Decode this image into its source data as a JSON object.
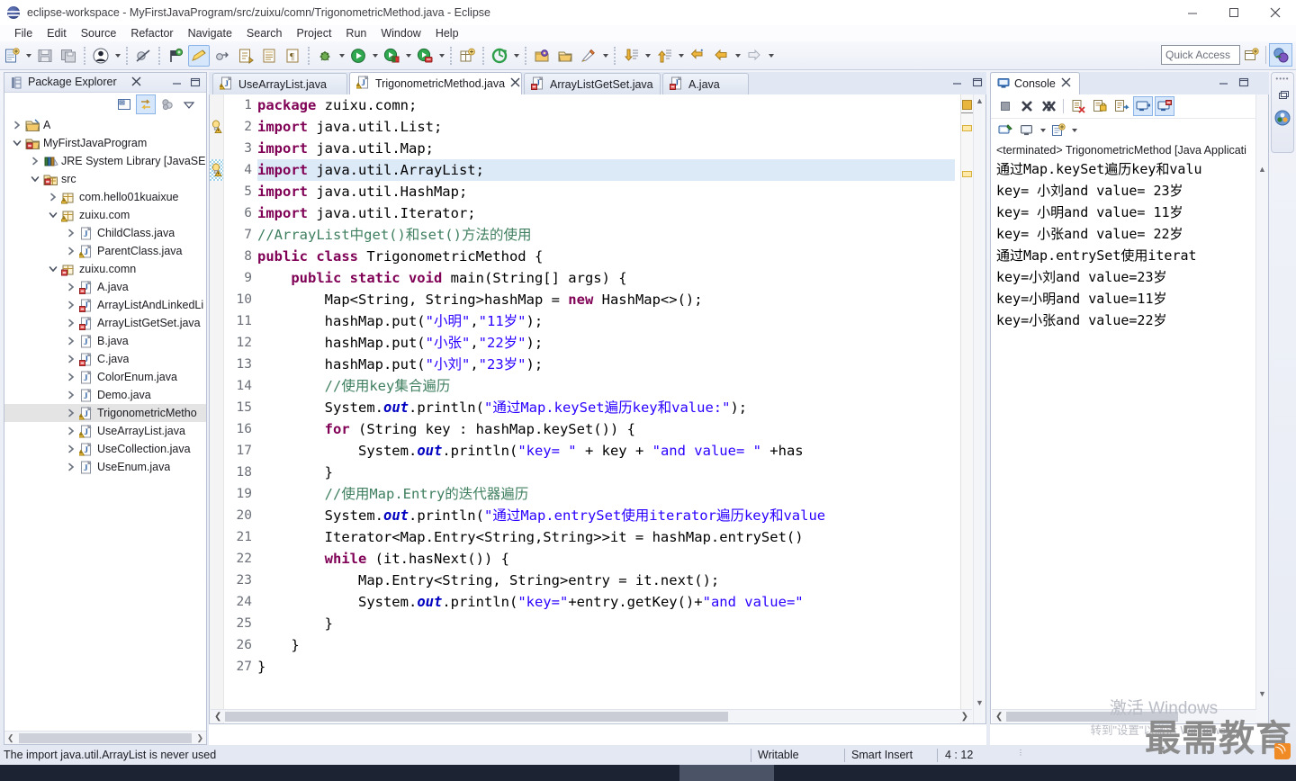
{
  "window": {
    "title": "eclipse-workspace - MyFirstJavaProgram/src/zuixu/comn/TrigonometricMethod.java - Eclipse",
    "app_icon": "eclipse-globe-icon",
    "minimize": "minimize-button",
    "maximize": "maximize-button",
    "close": "close-button"
  },
  "menu": {
    "items": [
      {
        "label": "File"
      },
      {
        "label": "Edit"
      },
      {
        "label": "Source"
      },
      {
        "label": "Refactor"
      },
      {
        "label": "Navigate"
      },
      {
        "label": "Search"
      },
      {
        "label": "Project"
      },
      {
        "label": "Run"
      },
      {
        "label": "Window"
      },
      {
        "label": "Help"
      }
    ]
  },
  "toolbar": {
    "buttons": [
      {
        "name": "new-wizard-icon",
        "kind": "new"
      },
      {
        "name": "new-dropdown-arrow",
        "kind": "arrow"
      },
      {
        "name": "save-icon",
        "kind": "save"
      },
      {
        "name": "save-all-icon",
        "kind": "saveall"
      },
      {
        "name": "sep1",
        "kind": "sep"
      },
      {
        "name": "person-icon",
        "kind": "person"
      },
      {
        "name": "person-dropdown-arrow",
        "kind": "arrow"
      },
      {
        "name": "sep2",
        "kind": "sep"
      },
      {
        "name": "skip-breakpoints-icon",
        "kind": "skip"
      },
      {
        "name": "sep3",
        "kind": "sep"
      },
      {
        "name": "toggle-breakpoint-icon",
        "kind": "flag"
      },
      {
        "name": "edit-pencil-icon",
        "kind": "pencil",
        "selected": true
      },
      {
        "name": "external-tools-icon",
        "kind": "ext"
      },
      {
        "name": "new-java-class-icon",
        "kind": "javaclass"
      },
      {
        "name": "new-java-interface-icon",
        "kind": "javaiface"
      },
      {
        "name": "paragraph-icon",
        "kind": "para"
      },
      {
        "name": "sep4",
        "kind": "sep"
      },
      {
        "name": "debug-bug-icon",
        "kind": "bug"
      },
      {
        "name": "debug-dropdown-arrow",
        "kind": "arrow"
      },
      {
        "name": "run-icon",
        "kind": "run"
      },
      {
        "name": "run-dropdown-arrow",
        "kind": "arrow"
      },
      {
        "name": "coverage-icon",
        "kind": "cov"
      },
      {
        "name": "coverage-dropdown-arrow",
        "kind": "arrow"
      },
      {
        "name": "run-last-icon",
        "kind": "runlast"
      },
      {
        "name": "run-last-dropdown-arrow",
        "kind": "arrow"
      },
      {
        "name": "sep5",
        "kind": "sep"
      },
      {
        "name": "new-package-icon",
        "kind": "newpkg"
      },
      {
        "name": "sep6",
        "kind": "sep"
      },
      {
        "name": "refresh-icon",
        "kind": "refresh"
      },
      {
        "name": "refresh-dropdown-arrow",
        "kind": "arrow"
      },
      {
        "name": "sep7",
        "kind": "sep"
      },
      {
        "name": "open-type-icon",
        "kind": "opentype"
      },
      {
        "name": "open-folder-icon",
        "kind": "openfolder"
      },
      {
        "name": "marker-pen-icon",
        "kind": "marker"
      },
      {
        "name": "marker-dropdown-arrow",
        "kind": "arrow"
      },
      {
        "name": "sep8",
        "kind": "sep"
      },
      {
        "name": "next-annotation-icon",
        "kind": "downarrow"
      },
      {
        "name": "next-annotation-dropdown-arrow",
        "kind": "arrow"
      },
      {
        "name": "previous-annotation-icon",
        "kind": "uparrow"
      },
      {
        "name": "previous-annotation-dropdown-arrow",
        "kind": "arrow"
      },
      {
        "name": "last-edit-location-icon",
        "kind": "lastedit"
      },
      {
        "name": "back-icon",
        "kind": "back"
      },
      {
        "name": "back-dropdown-arrow",
        "kind": "arrow"
      },
      {
        "name": "forward-icon",
        "kind": "forward"
      },
      {
        "name": "forward-dropdown-arrow",
        "kind": "arrow"
      }
    ],
    "quick_access_placeholder": "Quick Access",
    "perspective_new_icon": "open-perspective-icon",
    "perspective_java_icon": "java-perspective-icon"
  },
  "package_explorer": {
    "title": "Package Explorer",
    "view_icon": "package-explorer-icon",
    "close_icon": "close-icon",
    "minimize_icon": "minimize-icon",
    "maximize_icon": "maximize-icon",
    "toolbar": [
      {
        "name": "collapse-all-icon"
      },
      {
        "name": "link-with-editor-icon",
        "selected": true
      },
      {
        "name": "focus-on-active-task-icon"
      },
      {
        "name": "view-menu-icon"
      }
    ],
    "tree": [
      {
        "label": "A",
        "indent": 0,
        "expander": "collapsed",
        "icon": "project-closed-icon"
      },
      {
        "label": "MyFirstJavaProgram",
        "indent": 0,
        "expander": "expanded",
        "icon": "project-error-icon"
      },
      {
        "label": "JRE System Library [JavaSE-",
        "indent": 1,
        "expander": "collapsed",
        "icon": "library-icon"
      },
      {
        "label": "src",
        "indent": 1,
        "expander": "expanded",
        "icon": "source-folder-error-icon"
      },
      {
        "label": "com.hello01kuaixue",
        "indent": 2,
        "expander": "collapsed",
        "icon": "package-warning-icon"
      },
      {
        "label": "zuixu.com",
        "indent": 2,
        "expander": "expanded",
        "icon": "package-warning-icon"
      },
      {
        "label": "ChildClass.java",
        "indent": 3,
        "expander": "collapsed",
        "icon": "java-file-icon"
      },
      {
        "label": "ParentClass.java",
        "indent": 3,
        "expander": "collapsed",
        "icon": "java-file-warning-icon"
      },
      {
        "label": "zuixu.comn",
        "indent": 2,
        "expander": "expanded",
        "icon": "package-error-icon"
      },
      {
        "label": "A.java",
        "indent": 3,
        "expander": "collapsed",
        "icon": "java-file-error-icon"
      },
      {
        "label": "ArrayListAndLinkedLi",
        "indent": 3,
        "expander": "collapsed",
        "icon": "java-file-error-icon"
      },
      {
        "label": "ArrayListGetSet.java",
        "indent": 3,
        "expander": "collapsed",
        "icon": "java-file-error-icon"
      },
      {
        "label": "B.java",
        "indent": 3,
        "expander": "collapsed",
        "icon": "java-file-icon"
      },
      {
        "label": "C.java",
        "indent": 3,
        "expander": "collapsed",
        "icon": "java-file-error-icon"
      },
      {
        "label": "ColorEnum.java",
        "indent": 3,
        "expander": "collapsed",
        "icon": "java-file-icon"
      },
      {
        "label": "Demo.java",
        "indent": 3,
        "expander": "collapsed",
        "icon": "java-file-icon"
      },
      {
        "label": "TrigonometricMetho",
        "indent": 3,
        "expander": "collapsed",
        "icon": "java-file-warning-icon",
        "selected": true
      },
      {
        "label": "UseArrayList.java",
        "indent": 3,
        "expander": "collapsed",
        "icon": "java-file-warning-icon"
      },
      {
        "label": "UseCollection.java",
        "indent": 3,
        "expander": "collapsed",
        "icon": "java-file-warning-icon"
      },
      {
        "label": "UseEnum.java",
        "indent": 3,
        "expander": "collapsed",
        "icon": "java-file-icon"
      }
    ]
  },
  "editor": {
    "tabs": [
      {
        "label": "UseArrayList.java",
        "icon": "java-file-warning-icon",
        "active": false,
        "closable": false
      },
      {
        "label": "TrigonometricMethod.java",
        "icon": "java-file-warning-icon",
        "active": true,
        "closable": true
      },
      {
        "label": "ArrayListGetSet.java",
        "icon": "java-file-error-icon",
        "active": false,
        "closable": false
      },
      {
        "label": "A.java",
        "icon": "java-file-error-icon",
        "active": false,
        "closable": false
      }
    ],
    "minimize_icon": "minimize-icon",
    "maximize_icon": "maximize-icon",
    "highlighted_line": 4,
    "marker_lines": [
      {
        "line": 2,
        "icon": "warning-quickfix-icon"
      },
      {
        "line": 4,
        "icon": "warning-quickfix-icon",
        "occurrence": true
      }
    ],
    "fold_lines": [
      2,
      9
    ],
    "lines": [
      {
        "n": 1,
        "tokens": [
          {
            "t": "kw",
            "v": "package"
          },
          {
            "t": "p",
            "v": " zuixu.comn;"
          }
        ]
      },
      {
        "n": 2,
        "tokens": [
          {
            "t": "kw",
            "v": "import"
          },
          {
            "t": "p",
            "v": " java.util.List;"
          }
        ]
      },
      {
        "n": 3,
        "tokens": [
          {
            "t": "kw",
            "v": "import"
          },
          {
            "t": "p",
            "v": " java.util.Map;"
          }
        ]
      },
      {
        "n": 4,
        "tokens": [
          {
            "t": "kw",
            "v": "import"
          },
          {
            "t": "p",
            "v": " java.util.ArrayList;"
          }
        ]
      },
      {
        "n": 5,
        "tokens": [
          {
            "t": "kw",
            "v": "import"
          },
          {
            "t": "p",
            "v": " java.util.HashMap;"
          }
        ]
      },
      {
        "n": 6,
        "tokens": [
          {
            "t": "kw",
            "v": "import"
          },
          {
            "t": "p",
            "v": " java.util.Iterator;"
          }
        ]
      },
      {
        "n": 7,
        "tokens": [
          {
            "t": "cm",
            "v": "//ArrayList中get()和set()方法的使用"
          }
        ]
      },
      {
        "n": 8,
        "tokens": [
          {
            "t": "kw",
            "v": "public class"
          },
          {
            "t": "p",
            "v": " TrigonometricMethod {"
          }
        ]
      },
      {
        "n": 9,
        "tokens": [
          {
            "t": "p",
            "v": "    "
          },
          {
            "t": "kw",
            "v": "public static void"
          },
          {
            "t": "p",
            "v": " main(String[] args) {"
          }
        ]
      },
      {
        "n": 10,
        "tokens": [
          {
            "t": "p",
            "v": "        Map<String, String>hashMap = "
          },
          {
            "t": "kw",
            "v": "new"
          },
          {
            "t": "p",
            "v": " HashMap<>();"
          }
        ]
      },
      {
        "n": 11,
        "tokens": [
          {
            "t": "p",
            "v": "        hashMap.put("
          },
          {
            "t": "st",
            "v": "\"小明\""
          },
          {
            "t": "p",
            "v": ","
          },
          {
            "t": "st",
            "v": "\"11岁\""
          },
          {
            "t": "p",
            "v": ");"
          }
        ]
      },
      {
        "n": 12,
        "tokens": [
          {
            "t": "p",
            "v": "        hashMap.put("
          },
          {
            "t": "st",
            "v": "\"小张\""
          },
          {
            "t": "p",
            "v": ","
          },
          {
            "t": "st",
            "v": "\"22岁\""
          },
          {
            "t": "p",
            "v": ");"
          }
        ]
      },
      {
        "n": 13,
        "tokens": [
          {
            "t": "p",
            "v": "        hashMap.put("
          },
          {
            "t": "st",
            "v": "\"小刘\""
          },
          {
            "t": "p",
            "v": ","
          },
          {
            "t": "st",
            "v": "\"23岁\""
          },
          {
            "t": "p",
            "v": ");"
          }
        ]
      },
      {
        "n": 14,
        "tokens": [
          {
            "t": "p",
            "v": "        "
          },
          {
            "t": "cm",
            "v": "//使用key集合遍历"
          }
        ]
      },
      {
        "n": 15,
        "tokens": [
          {
            "t": "p",
            "v": "        System."
          },
          {
            "t": "fld",
            "v": "out"
          },
          {
            "t": "p",
            "v": ".println("
          },
          {
            "t": "st",
            "v": "\"通过Map.keySet遍历key和value:\""
          },
          {
            "t": "p",
            "v": ");"
          }
        ]
      },
      {
        "n": 16,
        "tokens": [
          {
            "t": "p",
            "v": "        "
          },
          {
            "t": "kw",
            "v": "for"
          },
          {
            "t": "p",
            "v": " (String key : hashMap.keySet()) {"
          }
        ]
      },
      {
        "n": 17,
        "tokens": [
          {
            "t": "p",
            "v": "            System."
          },
          {
            "t": "fld",
            "v": "out"
          },
          {
            "t": "p",
            "v": ".println("
          },
          {
            "t": "st",
            "v": "\"key= \""
          },
          {
            "t": "p",
            "v": " + key + "
          },
          {
            "t": "st",
            "v": "\"and value= \""
          },
          {
            "t": "p",
            "v": " +has"
          }
        ]
      },
      {
        "n": 18,
        "tokens": [
          {
            "t": "p",
            "v": "        }"
          }
        ]
      },
      {
        "n": 19,
        "tokens": [
          {
            "t": "p",
            "v": "        "
          },
          {
            "t": "cm",
            "v": "//使用Map.Entry的迭代器遍历"
          }
        ]
      },
      {
        "n": 20,
        "tokens": [
          {
            "t": "p",
            "v": "        System."
          },
          {
            "t": "fld",
            "v": "out"
          },
          {
            "t": "p",
            "v": ".println("
          },
          {
            "t": "st",
            "v": "\"通过Map.entrySet使用iterator遍历key和value"
          }
        ]
      },
      {
        "n": 21,
        "tokens": [
          {
            "t": "p",
            "v": "        Iterator<Map.Entry<String,String>>it = hashMap.entrySet()"
          }
        ]
      },
      {
        "n": 22,
        "tokens": [
          {
            "t": "p",
            "v": "        "
          },
          {
            "t": "kw",
            "v": "while"
          },
          {
            "t": "p",
            "v": " (it.hasNext()) {"
          }
        ]
      },
      {
        "n": 23,
        "tokens": [
          {
            "t": "p",
            "v": "            Map.Entry<String, String>entry = it.next();"
          }
        ]
      },
      {
        "n": 24,
        "tokens": [
          {
            "t": "p",
            "v": "            System."
          },
          {
            "t": "fld",
            "v": "out"
          },
          {
            "t": "p",
            "v": ".println("
          },
          {
            "t": "st",
            "v": "\"key=\""
          },
          {
            "t": "p",
            "v": "+entry.getKey()+"
          },
          {
            "t": "st",
            "v": "\"and value=\""
          }
        ]
      },
      {
        "n": 25,
        "tokens": [
          {
            "t": "p",
            "v": "        }"
          }
        ]
      },
      {
        "n": 26,
        "tokens": [
          {
            "t": "p",
            "v": "    }"
          }
        ]
      },
      {
        "n": 27,
        "tokens": [
          {
            "t": "p",
            "v": "}"
          }
        ]
      }
    ]
  },
  "console": {
    "title": "Console",
    "view_icon": "console-icon",
    "close_icon": "close-icon",
    "minimize_icon": "minimize-icon",
    "maximize_icon": "maximize-icon",
    "toolbar": [
      {
        "name": "terminate-icon"
      },
      {
        "name": "remove-launch-icon"
      },
      {
        "name": "remove-all-terminated-icon"
      },
      {
        "name": "sep-1",
        "kind": "sep"
      },
      {
        "name": "clear-console-icon"
      },
      {
        "name": "scroll-lock-icon"
      },
      {
        "name": "word-wrap-icon"
      },
      {
        "name": "show-console-on-output-icon",
        "selected": true
      },
      {
        "name": "show-console-on-error-icon",
        "selected": true
      }
    ],
    "toolbar2": [
      {
        "name": "pin-console-icon"
      },
      {
        "name": "display-selected-console-icon"
      },
      {
        "name": "display-console-dropdown-arrow",
        "kind": "arrow"
      },
      {
        "name": "open-console-icon"
      },
      {
        "name": "open-console-dropdown-arrow",
        "kind": "arrow"
      }
    ],
    "terminated_label": "<terminated> TrigonometricMethod [Java Applicati",
    "output": [
      "通过Map.keySet遍历key和valu",
      "key= 小刘and value= 23岁",
      "key= 小明and value= 11岁",
      "key= 小张and value= 22岁",
      "通过Map.entrySet使用iterat",
      "key=小刘and value=23岁",
      "key=小明and value=11岁",
      "key=小张and value=22岁"
    ]
  },
  "minibar": {
    "restore_icon": "restore-icon",
    "java_perspective_icon": "java-perspective-icon"
  },
  "status_bar": {
    "message": "The import java.util.ArrayList is never used",
    "writable": "Writable",
    "insert_mode": "Smart Insert",
    "cursor_position": "4 : 12"
  },
  "watermark": {
    "activate_line1": "激活 Windows",
    "activate_line2": "转到\"设置\"以激活 Windows。",
    "logo": "最需教育"
  },
  "colors": {
    "keyword": "#7f0055",
    "comment": "#3f7f5f",
    "string": "#2a00ff",
    "field": "#0000c0",
    "highlight_line": "#dce9f7",
    "accent_select": "#d6e6fb"
  }
}
